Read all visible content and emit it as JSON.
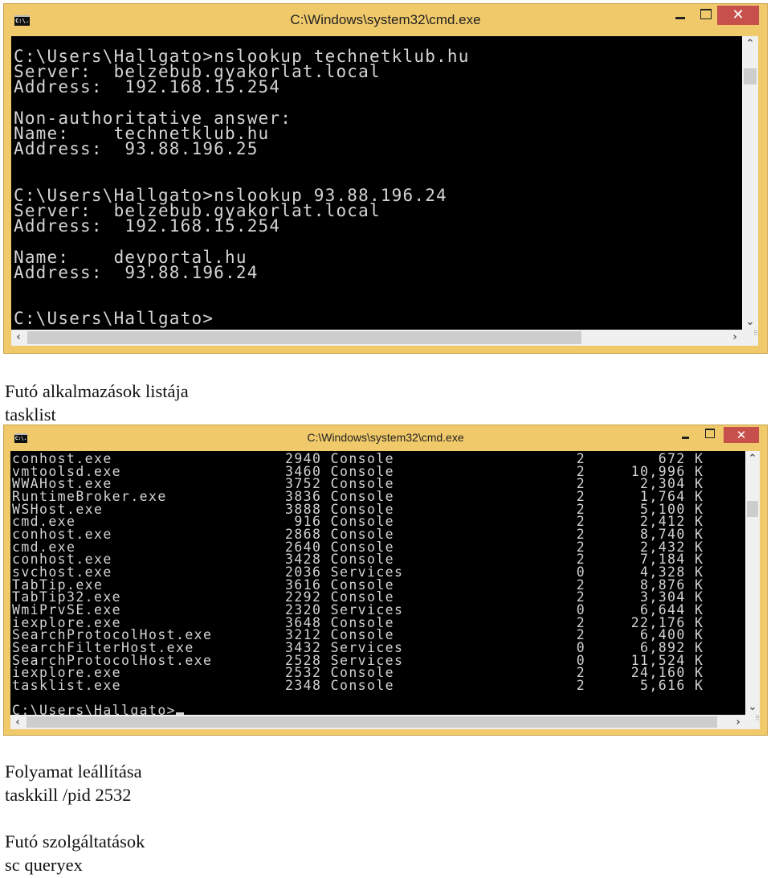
{
  "window1": {
    "title": "C:\\Windows\\system32\\cmd.exe",
    "icon_label": "C:\\.",
    "close_glyph": "✕",
    "lines": [
      "C:\\Users\\Hallgato>nslookup technetklub.hu",
      "Server:  belzebub.gyakorlat.local",
      "Address:  192.168.15.254",
      "",
      "Non-authoritative answer:",
      "Name:    technetklub.hu",
      "Address:  93.88.196.25",
      "",
      "",
      "C:\\Users\\Hallgato>nslookup 93.88.196.24",
      "Server:  belzebub.gyakorlat.local",
      "Address:  192.168.15.254",
      "",
      "Name:    devportal.hu",
      "Address:  93.88.196.24",
      "",
      "",
      "C:\\Users\\Hallgato>"
    ]
  },
  "caption1": {
    "heading": "Futó alkalmazások listája",
    "command": "tasklist"
  },
  "window2": {
    "title": "C:\\Windows\\system32\\cmd.exe",
    "icon_label": "C:\\.",
    "close_glyph": "✕",
    "processes": [
      {
        "name": "conhost.exe",
        "pid": "2940",
        "session": "Console",
        "num": "2",
        "mem": "672 K"
      },
      {
        "name": "vmtoolsd.exe",
        "pid": "3460",
        "session": "Console",
        "num": "2",
        "mem": "10,996 K"
      },
      {
        "name": "WWAHost.exe",
        "pid": "3752",
        "session": "Console",
        "num": "2",
        "mem": "2,304 K"
      },
      {
        "name": "RuntimeBroker.exe",
        "pid": "3836",
        "session": "Console",
        "num": "2",
        "mem": "1,764 K"
      },
      {
        "name": "WSHost.exe",
        "pid": "3888",
        "session": "Console",
        "num": "2",
        "mem": "5,100 K"
      },
      {
        "name": "cmd.exe",
        "pid": "916",
        "session": "Console",
        "num": "2",
        "mem": "2,412 K"
      },
      {
        "name": "conhost.exe",
        "pid": "2868",
        "session": "Console",
        "num": "2",
        "mem": "8,740 K"
      },
      {
        "name": "cmd.exe",
        "pid": "2640",
        "session": "Console",
        "num": "2",
        "mem": "2,432 K"
      },
      {
        "name": "conhost.exe",
        "pid": "3428",
        "session": "Console",
        "num": "2",
        "mem": "7,184 K"
      },
      {
        "name": "svchost.exe",
        "pid": "2036",
        "session": "Services",
        "num": "0",
        "mem": "4,328 K"
      },
      {
        "name": "TabTip.exe",
        "pid": "3616",
        "session": "Console",
        "num": "2",
        "mem": "8,876 K"
      },
      {
        "name": "TabTip32.exe",
        "pid": "2292",
        "session": "Console",
        "num": "2",
        "mem": "3,304 K"
      },
      {
        "name": "WmiPrvSE.exe",
        "pid": "2320",
        "session": "Services",
        "num": "0",
        "mem": "6,644 K"
      },
      {
        "name": "iexplore.exe",
        "pid": "3648",
        "session": "Console",
        "num": "2",
        "mem": "22,176 K"
      },
      {
        "name": "SearchProtocolHost.exe",
        "pid": "3212",
        "session": "Console",
        "num": "2",
        "mem": "6,400 K"
      },
      {
        "name": "SearchFilterHost.exe",
        "pid": "3432",
        "session": "Services",
        "num": "0",
        "mem": "6,892 K"
      },
      {
        "name": "SearchProtocolHost.exe",
        "pid": "2528",
        "session": "Services",
        "num": "0",
        "mem": "11,524 K"
      },
      {
        "name": "iexplore.exe",
        "pid": "2532",
        "session": "Console",
        "num": "2",
        "mem": "24,160 K"
      },
      {
        "name": "tasklist.exe",
        "pid": "2348",
        "session": "Console",
        "num": "2",
        "mem": "5,616 K"
      }
    ],
    "prompt": "C:\\Users\\Hallgato>"
  },
  "caption2": {
    "heading": "Folyamat leállítása",
    "command": "taskkill /pid 2532"
  },
  "caption3": {
    "heading": "Futó szolgáltatások",
    "command": "sc queryex"
  },
  "scroll_glyphs": {
    "up": "⌃",
    "down": "⌄",
    "left": "‹",
    "right": "›",
    "grip": "⠿"
  }
}
